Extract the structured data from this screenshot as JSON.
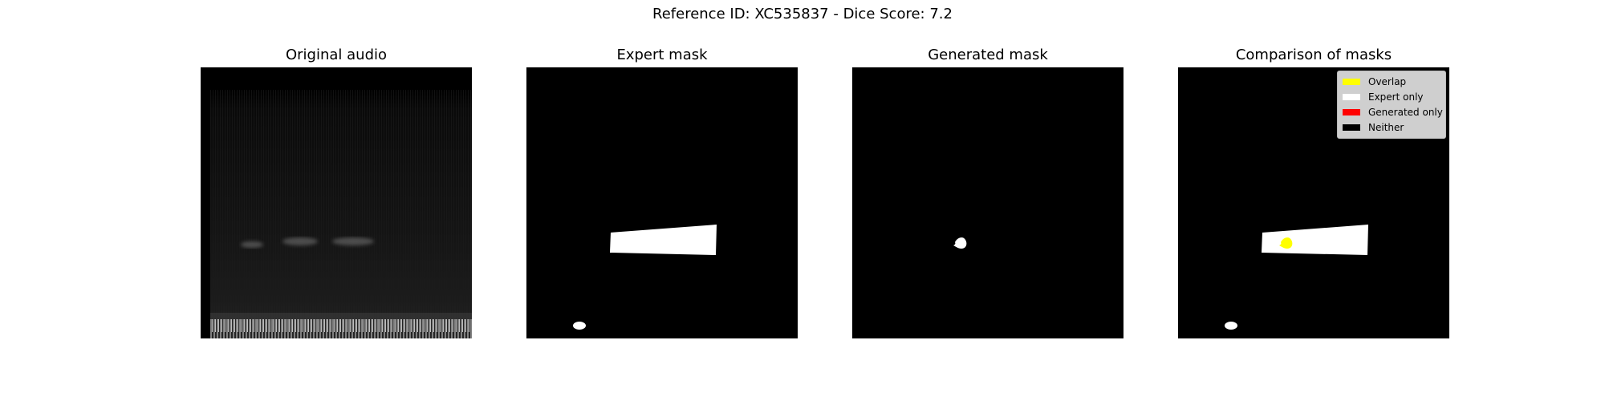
{
  "figure": {
    "suptitle": "Reference ID: XC535837 - Dice Score: 7.2"
  },
  "panels": {
    "original": {
      "title": "Original audio"
    },
    "expert": {
      "title": "Expert mask"
    },
    "generated": {
      "title": "Generated mask"
    },
    "comparison": {
      "title": "Comparison of masks"
    }
  },
  "legend": {
    "items": [
      {
        "label": "Overlap",
        "color": "#ffff00"
      },
      {
        "label": "Expert only",
        "color": "#ffffff"
      },
      {
        "label": "Generated only",
        "color": "#ff0000"
      },
      {
        "label": "Neither",
        "color": "#000000"
      }
    ]
  }
}
